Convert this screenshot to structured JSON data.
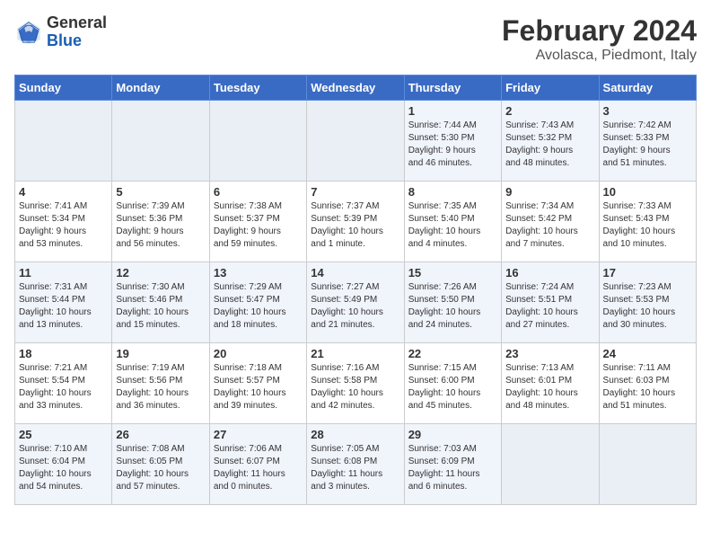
{
  "header": {
    "logo_general": "General",
    "logo_blue": "Blue",
    "month_title": "February 2024",
    "location": "Avolasca, Piedmont, Italy"
  },
  "weekdays": [
    "Sunday",
    "Monday",
    "Tuesday",
    "Wednesday",
    "Thursday",
    "Friday",
    "Saturday"
  ],
  "weeks": [
    [
      {
        "day": "",
        "info": ""
      },
      {
        "day": "",
        "info": ""
      },
      {
        "day": "",
        "info": ""
      },
      {
        "day": "",
        "info": ""
      },
      {
        "day": "1",
        "info": "Sunrise: 7:44 AM\nSunset: 5:30 PM\nDaylight: 9 hours\nand 46 minutes."
      },
      {
        "day": "2",
        "info": "Sunrise: 7:43 AM\nSunset: 5:32 PM\nDaylight: 9 hours\nand 48 minutes."
      },
      {
        "day": "3",
        "info": "Sunrise: 7:42 AM\nSunset: 5:33 PM\nDaylight: 9 hours\nand 51 minutes."
      }
    ],
    [
      {
        "day": "4",
        "info": "Sunrise: 7:41 AM\nSunset: 5:34 PM\nDaylight: 9 hours\nand 53 minutes."
      },
      {
        "day": "5",
        "info": "Sunrise: 7:39 AM\nSunset: 5:36 PM\nDaylight: 9 hours\nand 56 minutes."
      },
      {
        "day": "6",
        "info": "Sunrise: 7:38 AM\nSunset: 5:37 PM\nDaylight: 9 hours\nand 59 minutes."
      },
      {
        "day": "7",
        "info": "Sunrise: 7:37 AM\nSunset: 5:39 PM\nDaylight: 10 hours\nand 1 minute."
      },
      {
        "day": "8",
        "info": "Sunrise: 7:35 AM\nSunset: 5:40 PM\nDaylight: 10 hours\nand 4 minutes."
      },
      {
        "day": "9",
        "info": "Sunrise: 7:34 AM\nSunset: 5:42 PM\nDaylight: 10 hours\nand 7 minutes."
      },
      {
        "day": "10",
        "info": "Sunrise: 7:33 AM\nSunset: 5:43 PM\nDaylight: 10 hours\nand 10 minutes."
      }
    ],
    [
      {
        "day": "11",
        "info": "Sunrise: 7:31 AM\nSunset: 5:44 PM\nDaylight: 10 hours\nand 13 minutes."
      },
      {
        "day": "12",
        "info": "Sunrise: 7:30 AM\nSunset: 5:46 PM\nDaylight: 10 hours\nand 15 minutes."
      },
      {
        "day": "13",
        "info": "Sunrise: 7:29 AM\nSunset: 5:47 PM\nDaylight: 10 hours\nand 18 minutes."
      },
      {
        "day": "14",
        "info": "Sunrise: 7:27 AM\nSunset: 5:49 PM\nDaylight: 10 hours\nand 21 minutes."
      },
      {
        "day": "15",
        "info": "Sunrise: 7:26 AM\nSunset: 5:50 PM\nDaylight: 10 hours\nand 24 minutes."
      },
      {
        "day": "16",
        "info": "Sunrise: 7:24 AM\nSunset: 5:51 PM\nDaylight: 10 hours\nand 27 minutes."
      },
      {
        "day": "17",
        "info": "Sunrise: 7:23 AM\nSunset: 5:53 PM\nDaylight: 10 hours\nand 30 minutes."
      }
    ],
    [
      {
        "day": "18",
        "info": "Sunrise: 7:21 AM\nSunset: 5:54 PM\nDaylight: 10 hours\nand 33 minutes."
      },
      {
        "day": "19",
        "info": "Sunrise: 7:19 AM\nSunset: 5:56 PM\nDaylight: 10 hours\nand 36 minutes."
      },
      {
        "day": "20",
        "info": "Sunrise: 7:18 AM\nSunset: 5:57 PM\nDaylight: 10 hours\nand 39 minutes."
      },
      {
        "day": "21",
        "info": "Sunrise: 7:16 AM\nSunset: 5:58 PM\nDaylight: 10 hours\nand 42 minutes."
      },
      {
        "day": "22",
        "info": "Sunrise: 7:15 AM\nSunset: 6:00 PM\nDaylight: 10 hours\nand 45 minutes."
      },
      {
        "day": "23",
        "info": "Sunrise: 7:13 AM\nSunset: 6:01 PM\nDaylight: 10 hours\nand 48 minutes."
      },
      {
        "day": "24",
        "info": "Sunrise: 7:11 AM\nSunset: 6:03 PM\nDaylight: 10 hours\nand 51 minutes."
      }
    ],
    [
      {
        "day": "25",
        "info": "Sunrise: 7:10 AM\nSunset: 6:04 PM\nDaylight: 10 hours\nand 54 minutes."
      },
      {
        "day": "26",
        "info": "Sunrise: 7:08 AM\nSunset: 6:05 PM\nDaylight: 10 hours\nand 57 minutes."
      },
      {
        "day": "27",
        "info": "Sunrise: 7:06 AM\nSunset: 6:07 PM\nDaylight: 11 hours\nand 0 minutes."
      },
      {
        "day": "28",
        "info": "Sunrise: 7:05 AM\nSunset: 6:08 PM\nDaylight: 11 hours\nand 3 minutes."
      },
      {
        "day": "29",
        "info": "Sunrise: 7:03 AM\nSunset: 6:09 PM\nDaylight: 11 hours\nand 6 minutes."
      },
      {
        "day": "",
        "info": ""
      },
      {
        "day": "",
        "info": ""
      }
    ]
  ]
}
